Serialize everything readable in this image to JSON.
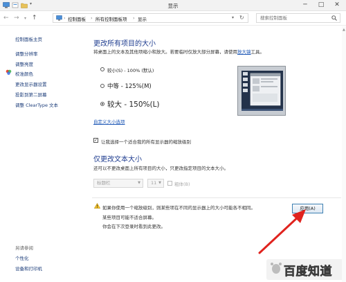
{
  "window": {
    "title": "显示",
    "controls": {
      "minimize": "─",
      "maximize": "□",
      "close": "✕"
    }
  },
  "nav": {
    "back": "←",
    "forward": "→",
    "recent": "▾",
    "up": "↑"
  },
  "address": {
    "crumbs": [
      "控制面板",
      "所有控制面板项",
      "显示"
    ],
    "separator": "›"
  },
  "search": {
    "placeholder": "搜索控制面板"
  },
  "sidebar": {
    "items": [
      {
        "label": "控制面板主页"
      },
      {
        "label": "调整分辨率"
      },
      {
        "label": "调整亮度"
      },
      {
        "label": "校准颜色"
      },
      {
        "label": "更改显示器设置"
      },
      {
        "label": "投影到第二屏幕"
      },
      {
        "label": "调整 ClearType 文本"
      }
    ],
    "see_also": {
      "heading": "另请参阅",
      "items": [
        {
          "label": "个性化"
        },
        {
          "label": "设备和打印机"
        }
      ]
    }
  },
  "main": {
    "resize_all": {
      "title": "更改所有项目的大小",
      "desc": "将桌面上的文本及其他项缩小和放大。若要临时仅放大部分屏幕，请使用",
      "magnifier_link": "放大镜",
      "desc_tail": "工具。",
      "options": [
        {
          "label": "较小(S) - 100% (默认)",
          "selected": false
        },
        {
          "label": "中等 - 125%(M)",
          "selected": false
        },
        {
          "label": "较大 - 150%(L)",
          "selected": true
        }
      ],
      "custom_link": "自定义大小选项"
    },
    "one_scale": {
      "label": "让我选择一个适合我的所有显示器的缩放级别",
      "checked": true
    },
    "text_only": {
      "title": "仅更改文本大小",
      "desc": "还可以不更改桌面上所有项目的大小，只更改指定项目的文本大小。",
      "element": "标题栏",
      "size": "11",
      "bold_label": "粗体(B)",
      "bold_checked": false
    },
    "warning": {
      "line1": "如果你使用一个缩放级别，则某些项在不同的显示器上的大小可能各不相同。",
      "line2": "某些项目可能不适合屏幕。",
      "line3": "你会在下次登录时看到此更改。"
    },
    "apply_label": "应用(A)"
  },
  "watermark": {
    "text": "百度知道"
  },
  "colors": {
    "heading": "#1e3c8f",
    "link": "#1a55b5",
    "arrow": "#e0231e"
  }
}
